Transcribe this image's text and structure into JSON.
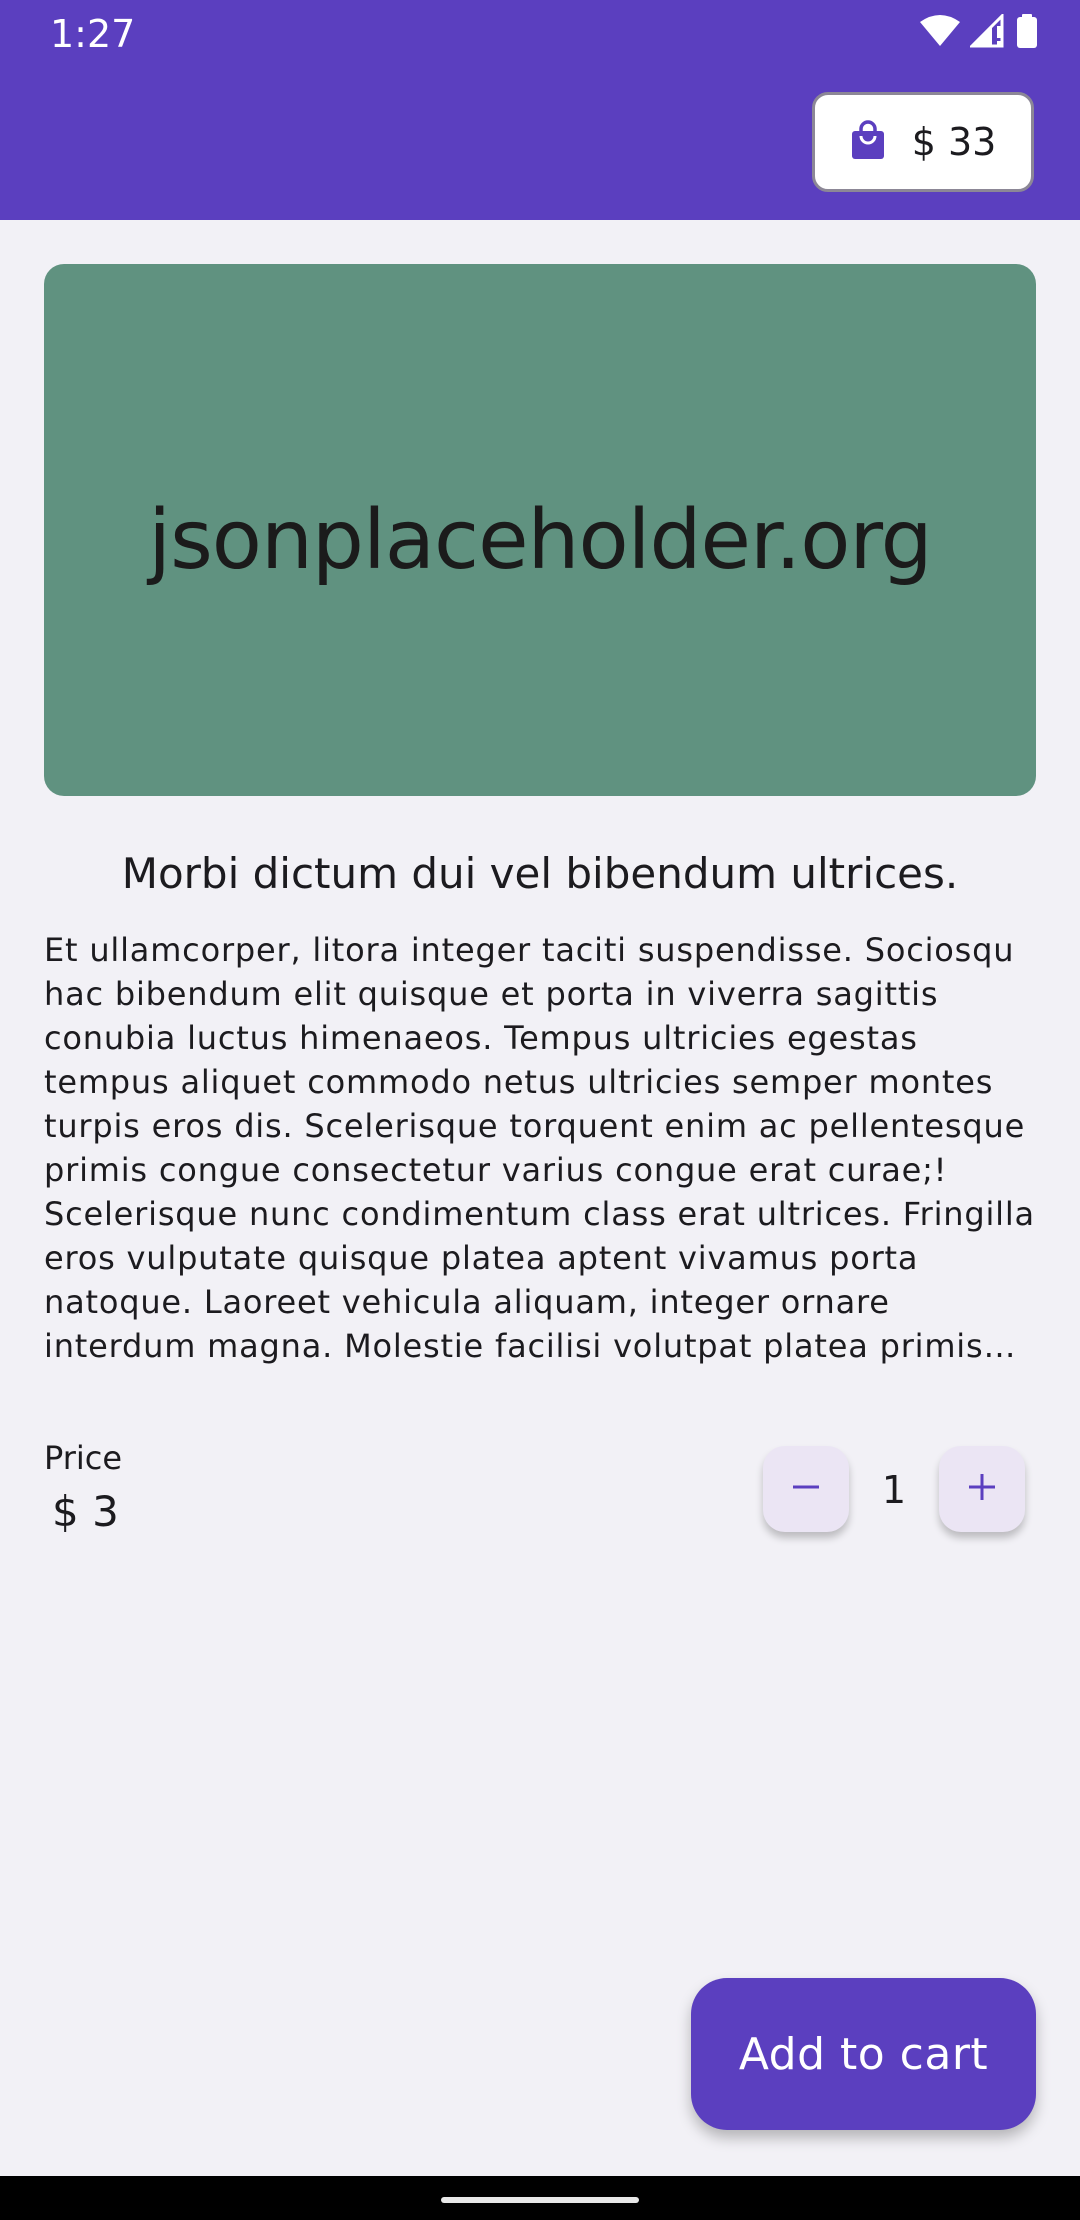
{
  "status_bar": {
    "time": "1:27"
  },
  "header": {
    "cart_total": "$ 33",
    "cart_icon": "shopping-bag-icon"
  },
  "product": {
    "image_text": "jsonplaceholder.org",
    "title": "Morbi dictum dui vel bibendum ultrices.",
    "description": "Et ullamcorper, litora integer taciti suspendisse. Sociosqu hac bibendum elit quisque et porta in viverra sagittis conubia luctus himenaeos. Tempus ultricies egestas tempus aliquet commodo netus ultricies semper montes turpis eros dis. Scelerisque torquent enim ac pellentesque primis congue consectetur varius congue erat curae;! Scelerisque nunc condimentum class erat ultrices. Fringilla eros vulputate quisque platea aptent vivamus porta natoque. Laoreet vehicula aliquam, integer ornare interdum magna. Molestie facilisi volutpat platea primis aptent facilisi etiam …",
    "price_label": "Price",
    "price_value": "$ 3"
  },
  "quantity": {
    "value": "1",
    "decrement_icon": "minus-icon",
    "increment_icon": "plus-icon"
  },
  "actions": {
    "add_to_cart_label": "Add to cart"
  },
  "colors": {
    "primary": "#5b3fbf",
    "background": "#f2f1f6",
    "image_placeholder": "#609280",
    "qty_button_bg": "#ebe5f4"
  }
}
